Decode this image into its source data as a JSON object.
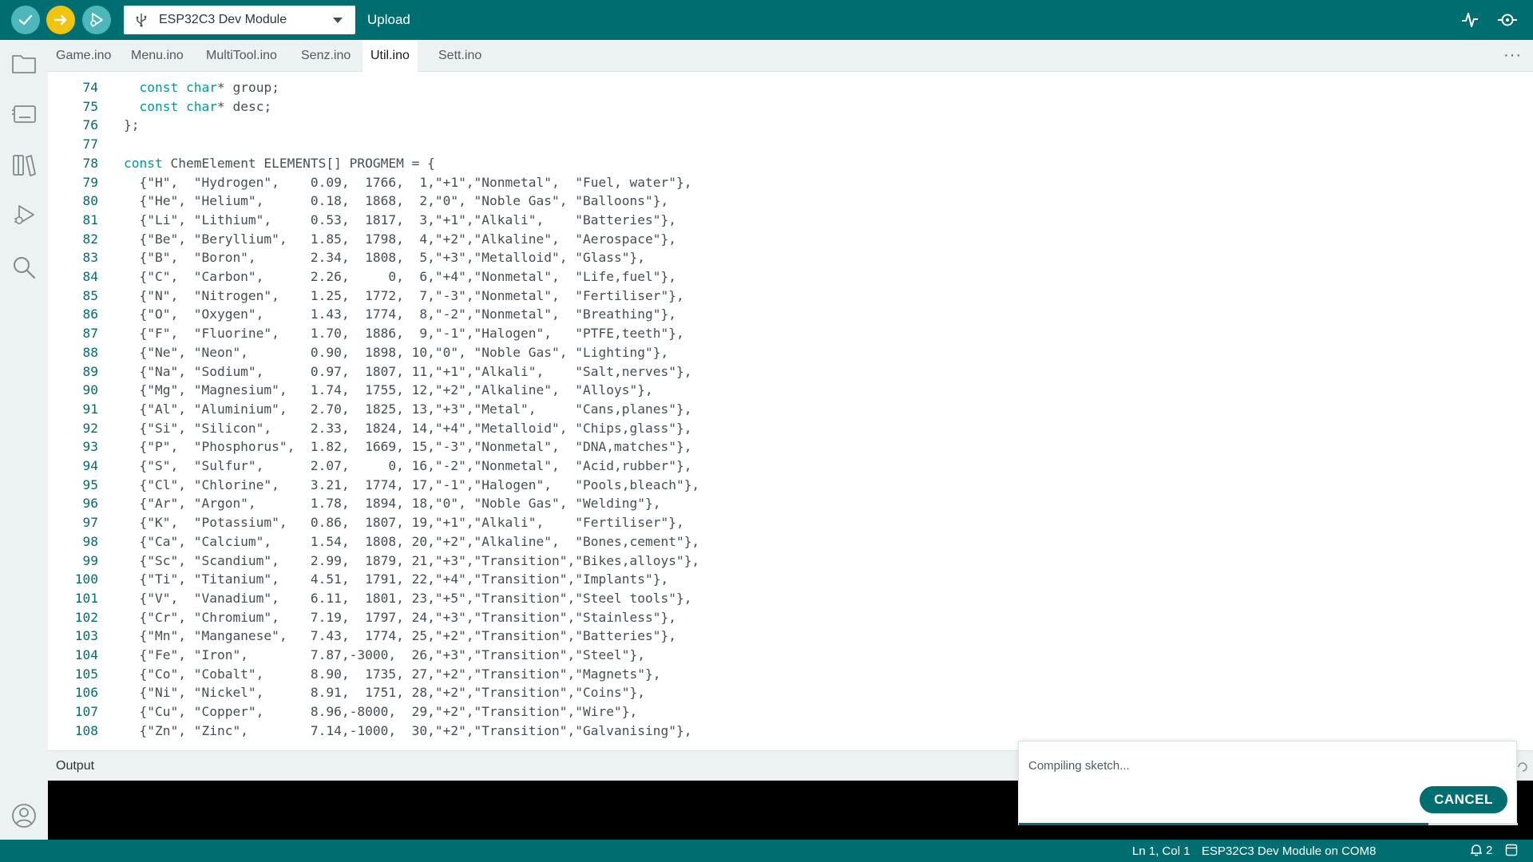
{
  "toolbar": {
    "board_name": "ESP32C3 Dev Module",
    "upload_label": "Upload",
    "icons": {
      "verify": "checkmark-icon",
      "upload": "arrow-right-icon",
      "debug": "debug-play-icon",
      "board": "usb-icon",
      "plotter": "serial-plotter-icon",
      "monitor": "serial-monitor-icon"
    }
  },
  "rail": {
    "icons": [
      "folder-icon",
      "boards-manager-icon",
      "library-manager-icon",
      "debug-icon",
      "search-icon",
      "account-icon"
    ]
  },
  "tabs": [
    {
      "label": "Game.ino",
      "active": false
    },
    {
      "label": "Menu.ino",
      "active": false
    },
    {
      "label": "MultiTool.ino",
      "active": false
    },
    {
      "label": "Senz.ino",
      "active": false
    },
    {
      "label": "Util.ino",
      "active": true
    },
    {
      "label": "Sett.ino",
      "active": false
    }
  ],
  "tabs_more": "···",
  "editor": {
    "lines": [
      {
        "n": "74",
        "text": "  const char* group;"
      },
      {
        "n": "75",
        "text": "  const char* desc;"
      },
      {
        "n": "76",
        "text": "};"
      },
      {
        "n": "77",
        "text": ""
      },
      {
        "n": "78",
        "text": "const ChemElement ELEMENTS[] PROGMEM = {"
      },
      {
        "n": "79",
        "text": "  {\"H\",  \"Hydrogen\",    0.09,  1766,  1,\"+1\",\"Nonmetal\",  \"Fuel, water\"},"
      },
      {
        "n": "80",
        "text": "  {\"He\", \"Helium\",      0.18,  1868,  2,\"0\", \"Noble Gas\", \"Balloons\"},"
      },
      {
        "n": "81",
        "text": "  {\"Li\", \"Lithium\",     0.53,  1817,  3,\"+1\",\"Alkali\",    \"Batteries\"},"
      },
      {
        "n": "82",
        "text": "  {\"Be\", \"Beryllium\",   1.85,  1798,  4,\"+2\",\"Alkaline\",  \"Aerospace\"},"
      },
      {
        "n": "83",
        "text": "  {\"B\",  \"Boron\",       2.34,  1808,  5,\"+3\",\"Metalloid\", \"Glass\"},"
      },
      {
        "n": "84",
        "text": "  {\"C\",  \"Carbon\",      2.26,     0,  6,\"+4\",\"Nonmetal\",  \"Life,fuel\"},"
      },
      {
        "n": "85",
        "text": "  {\"N\",  \"Nitrogen\",    1.25,  1772,  7,\"-3\",\"Nonmetal\",  \"Fertiliser\"},"
      },
      {
        "n": "86",
        "text": "  {\"O\",  \"Oxygen\",      1.43,  1774,  8,\"-2\",\"Nonmetal\",  \"Breathing\"},"
      },
      {
        "n": "87",
        "text": "  {\"F\",  \"Fluorine\",    1.70,  1886,  9,\"-1\",\"Halogen\",   \"PTFE,teeth\"},"
      },
      {
        "n": "88",
        "text": "  {\"Ne\", \"Neon\",        0.90,  1898, 10,\"0\", \"Noble Gas\", \"Lighting\"},"
      },
      {
        "n": "89",
        "text": "  {\"Na\", \"Sodium\",      0.97,  1807, 11,\"+1\",\"Alkali\",    \"Salt,nerves\"},"
      },
      {
        "n": "90",
        "text": "  {\"Mg\", \"Magnesium\",   1.74,  1755, 12,\"+2\",\"Alkaline\",  \"Alloys\"},"
      },
      {
        "n": "91",
        "text": "  {\"Al\", \"Aluminium\",   2.70,  1825, 13,\"+3\",\"Metal\",     \"Cans,planes\"},"
      },
      {
        "n": "92",
        "text": "  {\"Si\", \"Silicon\",     2.33,  1824, 14,\"+4\",\"Metalloid\", \"Chips,glass\"},"
      },
      {
        "n": "93",
        "text": "  {\"P\",  \"Phosphorus\",  1.82,  1669, 15,\"-3\",\"Nonmetal\",  \"DNA,matches\"},"
      },
      {
        "n": "94",
        "text": "  {\"S\",  \"Sulfur\",      2.07,     0, 16,\"-2\",\"Nonmetal\",  \"Acid,rubber\"},"
      },
      {
        "n": "95",
        "text": "  {\"Cl\", \"Chlorine\",    3.21,  1774, 17,\"-1\",\"Halogen\",   \"Pools,bleach\"},"
      },
      {
        "n": "96",
        "text": "  {\"Ar\", \"Argon\",       1.78,  1894, 18,\"0\", \"Noble Gas\", \"Welding\"},"
      },
      {
        "n": "97",
        "text": "  {\"K\",  \"Potassium\",   0.86,  1807, 19,\"+1\",\"Alkali\",    \"Fertiliser\"},"
      },
      {
        "n": "98",
        "text": "  {\"Ca\", \"Calcium\",     1.54,  1808, 20,\"+2\",\"Alkaline\",  \"Bones,cement\"},"
      },
      {
        "n": "99",
        "text": "  {\"Sc\", \"Scandium\",    2.99,  1879, 21,\"+3\",\"Transition\",\"Bikes,alloys\"},"
      },
      {
        "n": "100",
        "text": "  {\"Ti\", \"Titanium\",    4.51,  1791, 22,\"+4\",\"Transition\",\"Implants\"},"
      },
      {
        "n": "101",
        "text": "  {\"V\",  \"Vanadium\",    6.11,  1801, 23,\"+5\",\"Transition\",\"Steel tools\"},"
      },
      {
        "n": "102",
        "text": "  {\"Cr\", \"Chromium\",    7.19,  1797, 24,\"+3\",\"Transition\",\"Stainless\"},"
      },
      {
        "n": "103",
        "text": "  {\"Mn\", \"Manganese\",   7.43,  1774, 25,\"+2\",\"Transition\",\"Batteries\"},"
      },
      {
        "n": "104",
        "text": "  {\"Fe\", \"Iron\",        7.87,-3000,  26,\"+3\",\"Transition\",\"Steel\"},"
      },
      {
        "n": "105",
        "text": "  {\"Co\", \"Cobalt\",      8.90,  1735, 27,\"+2\",\"Transition\",\"Magnets\"},"
      },
      {
        "n": "106",
        "text": "  {\"Ni\", \"Nickel\",      8.91,  1751, 28,\"+2\",\"Transition\",\"Coins\"},"
      },
      {
        "n": "107",
        "text": "  {\"Cu\", \"Copper\",      8.96,-8000,  29,\"+2\",\"Transition\",\"Wire\"},"
      },
      {
        "n": "108",
        "text": "  {\"Zn\", \"Zinc\",        7.14,-1000,  30,\"+2\",\"Transition\",\"Galvanising\"},"
      }
    ]
  },
  "output": {
    "title": "Output"
  },
  "toast": {
    "message": "Compiling sketch...",
    "cancel_label": "CANCEL",
    "progress": 0.82
  },
  "status": {
    "position": "Ln 1, Col 1",
    "board": "ESP32C3 Dev Module on COM8",
    "notifications": "2"
  },
  "colors": {
    "teal": "#006d70",
    "upload_yellow": "#f1c40f",
    "verify_teal_light": "#4db7bb",
    "keyword": "#00979d",
    "line_number": "#006d70"
  }
}
